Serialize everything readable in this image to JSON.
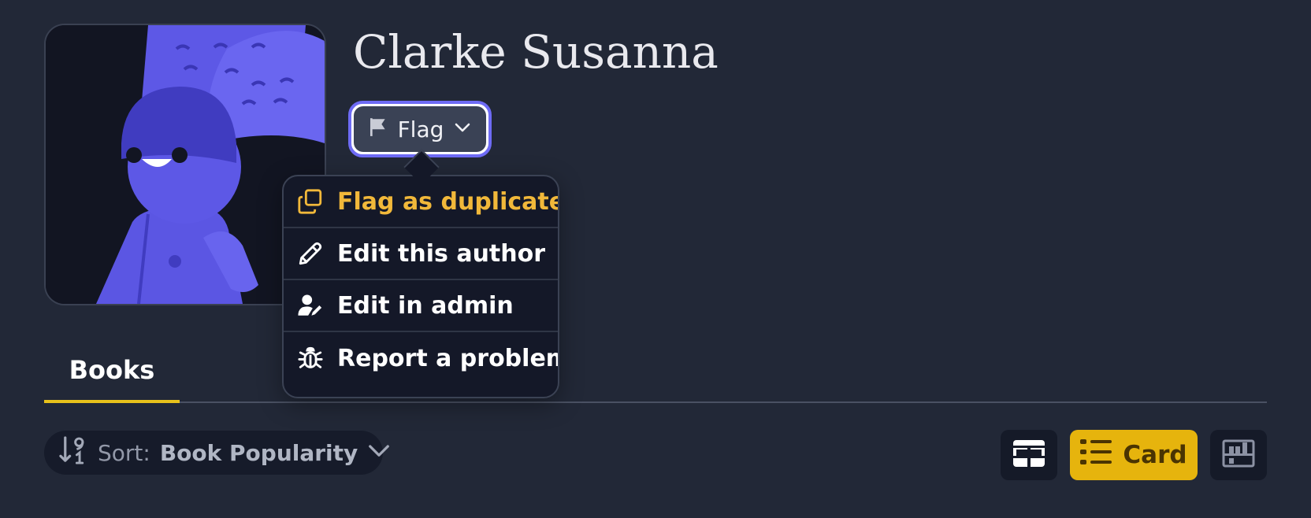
{
  "author": {
    "name": "Clarke Susanna"
  },
  "flag_button": {
    "label": "Flag",
    "icon": "flag-icon",
    "caret_icon": "chevron-down-icon"
  },
  "flag_menu": {
    "items": [
      {
        "label": "Flag as duplicate",
        "icon": "copy-icon",
        "highlighted": true
      },
      {
        "label": "Edit this author",
        "icon": "pencil-icon",
        "highlighted": false
      },
      {
        "label": "Edit in admin",
        "icon": "user-edit-icon",
        "highlighted": false
      },
      {
        "label": "Report a problem",
        "icon": "bug-icon",
        "highlighted": false
      }
    ]
  },
  "tabs": [
    {
      "label": "Books",
      "active": true
    }
  ],
  "sort": {
    "label": "Sort:",
    "value": "Book Popularity",
    "icon": "sort-numeric-icon"
  },
  "view_modes": [
    {
      "name": "table",
      "icon": "table-icon",
      "active": false
    },
    {
      "name": "card",
      "label": "Card",
      "icon": "list-icon",
      "active": true
    },
    {
      "name": "shelf",
      "icon": "bookshelf-icon",
      "active": false
    }
  ],
  "colors": {
    "background": "#222837",
    "accent": "#e6b40d",
    "focus_ring": "#6e6bf5",
    "highlight_text": "#f1b83a"
  }
}
